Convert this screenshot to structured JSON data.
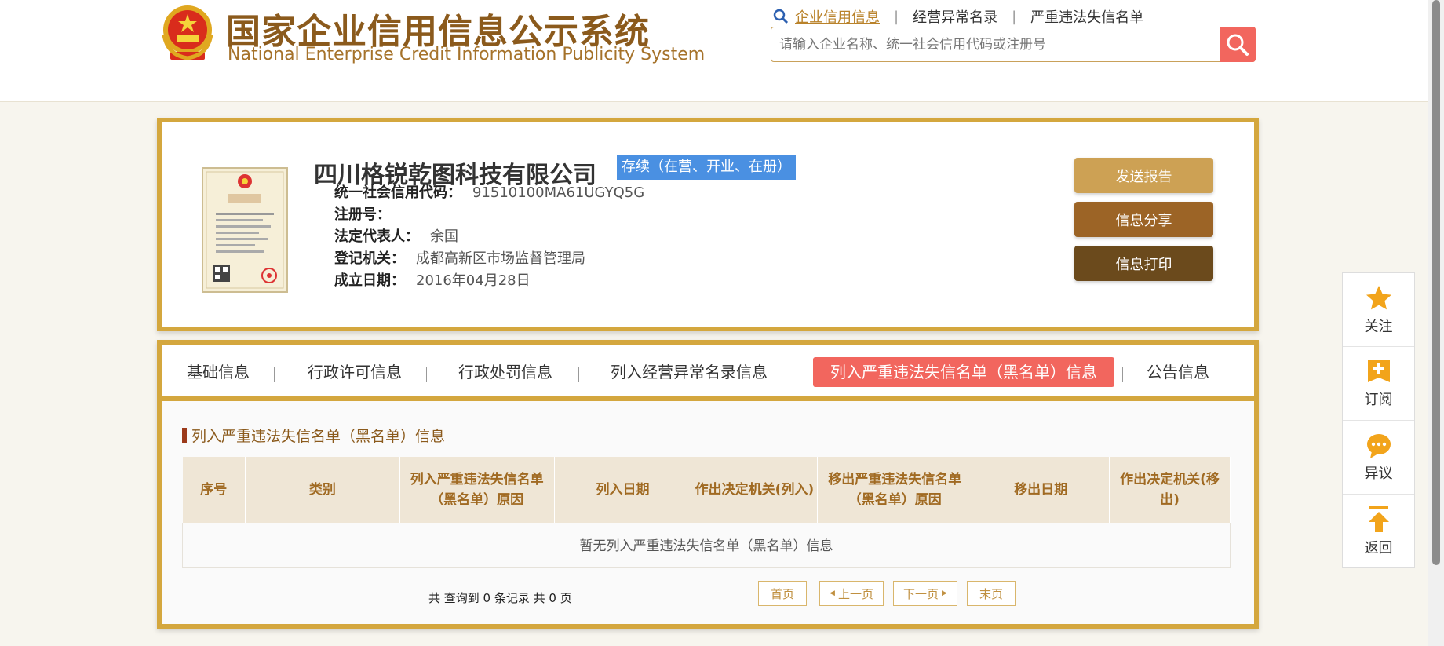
{
  "header": {
    "title_cn": "国家企业信用信息公示系统",
    "title_en": "National Enterprise Credit Information Publicity System",
    "nav": [
      {
        "label": "企业信用信息",
        "active": true
      },
      {
        "label": "经营异常名录",
        "active": false
      },
      {
        "label": "严重违法失信名单",
        "active": false
      }
    ],
    "nav_separator": "|",
    "search_placeholder": "请输入企业名称、统一社会信用代码或注册号"
  },
  "company": {
    "name": "四川格锐乾图科技有限公司",
    "status": "存续（在营、开业、在册）",
    "fields": [
      {
        "label": "统一社会信用代码：",
        "value": "91510100MA61UGYQ5G"
      },
      {
        "label": "注册号：",
        "value": ""
      },
      {
        "label": "法定代表人：",
        "value": "余国"
      },
      {
        "label": "登记机关：",
        "value": "成都高新区市场监督管理局"
      },
      {
        "label": "成立日期：",
        "value": "2016年04月28日"
      }
    ],
    "buttons": {
      "report": "发送报告",
      "share": "信息分享",
      "print": "信息打印"
    },
    "license_title": "营业执照"
  },
  "tabs": [
    {
      "label": "基础信息",
      "active": false
    },
    {
      "label": "行政许可信息",
      "active": false
    },
    {
      "label": "行政处罚信息",
      "active": false
    },
    {
      "label": "列入经营异常名录信息",
      "active": false
    },
    {
      "label": "列入严重违法失信名单（黑名单）信息",
      "active": true
    },
    {
      "label": "公告信息",
      "active": false
    }
  ],
  "section": {
    "title": "列入严重违法失信名单（黑名单）信息",
    "columns": [
      "序号",
      "类别",
      "列入严重违法失信名单（黑名单）原因",
      "列入日期",
      "作出决定机关(列入)",
      "移出严重违法失信名单（黑名单）原因",
      "移出日期",
      "作出决定机关(移出)"
    ],
    "empty_text": "暂无列入严重违法失信名单（黑名单）信息"
  },
  "pagination": {
    "summary": "共 查询到 0 条记录 共 0 页",
    "first": "首页",
    "prev": "上一页",
    "next": "下一页",
    "last": "末页"
  },
  "sidebar": [
    {
      "label": "关注",
      "icon": "star-icon"
    },
    {
      "label": "订阅",
      "icon": "subscribe-icon"
    },
    {
      "label": "异议",
      "icon": "comment-icon"
    },
    {
      "label": "返回",
      "icon": "back-to-top-icon"
    }
  ],
  "colors": {
    "brand": "#8b5a1c",
    "border_gold": "#d4a73e",
    "accent_red": "#f2665e",
    "status_blue": "#4a90e2"
  }
}
